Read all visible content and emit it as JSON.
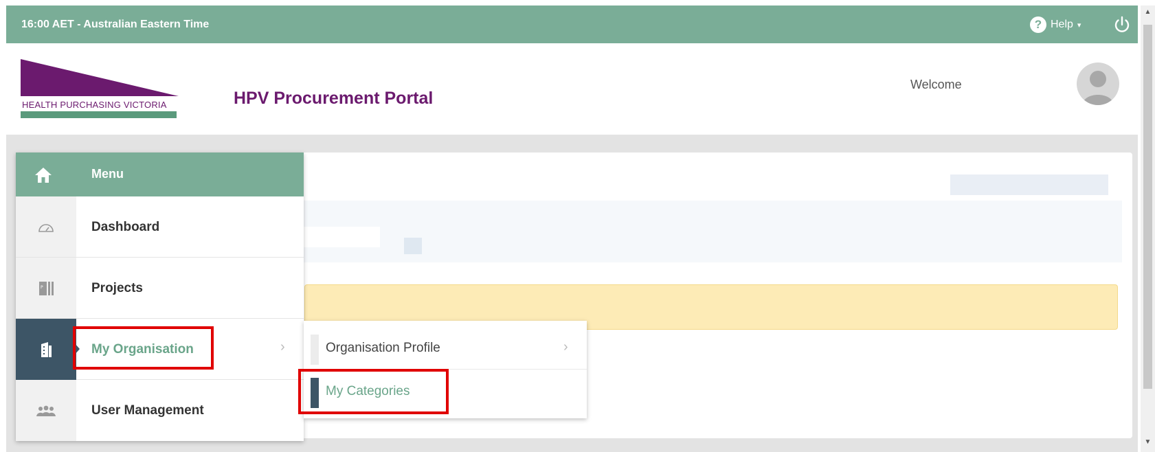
{
  "topbar": {
    "time": "16:00 AET - Australian Eastern Time",
    "help_label": "Help",
    "help_icon": "question-circle-icon",
    "power_icon": "power-icon"
  },
  "header": {
    "logo_text": "HEALTH PURCHASING VICTORIA",
    "portal_title": "HPV Procurement Portal",
    "welcome": "Welcome"
  },
  "menu": {
    "title": "Menu",
    "items": [
      {
        "label": "Dashboard",
        "icon": "gauge-icon"
      },
      {
        "label": "Projects",
        "icon": "projects-icon"
      },
      {
        "label": "My Organisation",
        "icon": "building-icon",
        "active": true
      },
      {
        "label": "User Management",
        "icon": "users-icon"
      }
    ]
  },
  "submenu": {
    "items": [
      {
        "label": "Organisation Profile"
      },
      {
        "label": "My Categories",
        "selected": true
      }
    ]
  },
  "colors": {
    "accent": "#7aad97",
    "brand_purple": "#6b1a6e",
    "active_dark": "#3d5566",
    "highlight_red": "#e00000",
    "alert_yellow": "#fdebb6"
  }
}
